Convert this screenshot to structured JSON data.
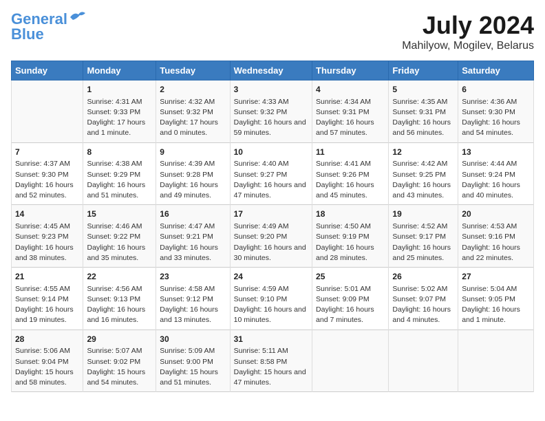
{
  "header": {
    "logo_line1": "General",
    "logo_line2": "Blue",
    "main_title": "July 2024",
    "subtitle": "Mahilyow, Mogilev, Belarus"
  },
  "columns": [
    "Sunday",
    "Monday",
    "Tuesday",
    "Wednesday",
    "Thursday",
    "Friday",
    "Saturday"
  ],
  "weeks": [
    [
      {
        "day": "",
        "sunrise": "",
        "sunset": "",
        "daylight": ""
      },
      {
        "day": "1",
        "sunrise": "Sunrise: 4:31 AM",
        "sunset": "Sunset: 9:33 PM",
        "daylight": "Daylight: 17 hours and 1 minute."
      },
      {
        "day": "2",
        "sunrise": "Sunrise: 4:32 AM",
        "sunset": "Sunset: 9:32 PM",
        "daylight": "Daylight: 17 hours and 0 minutes."
      },
      {
        "day": "3",
        "sunrise": "Sunrise: 4:33 AM",
        "sunset": "Sunset: 9:32 PM",
        "daylight": "Daylight: 16 hours and 59 minutes."
      },
      {
        "day": "4",
        "sunrise": "Sunrise: 4:34 AM",
        "sunset": "Sunset: 9:31 PM",
        "daylight": "Daylight: 16 hours and 57 minutes."
      },
      {
        "day": "5",
        "sunrise": "Sunrise: 4:35 AM",
        "sunset": "Sunset: 9:31 PM",
        "daylight": "Daylight: 16 hours and 56 minutes."
      },
      {
        "day": "6",
        "sunrise": "Sunrise: 4:36 AM",
        "sunset": "Sunset: 9:30 PM",
        "daylight": "Daylight: 16 hours and 54 minutes."
      }
    ],
    [
      {
        "day": "7",
        "sunrise": "Sunrise: 4:37 AM",
        "sunset": "Sunset: 9:30 PM",
        "daylight": "Daylight: 16 hours and 52 minutes."
      },
      {
        "day": "8",
        "sunrise": "Sunrise: 4:38 AM",
        "sunset": "Sunset: 9:29 PM",
        "daylight": "Daylight: 16 hours and 51 minutes."
      },
      {
        "day": "9",
        "sunrise": "Sunrise: 4:39 AM",
        "sunset": "Sunset: 9:28 PM",
        "daylight": "Daylight: 16 hours and 49 minutes."
      },
      {
        "day": "10",
        "sunrise": "Sunrise: 4:40 AM",
        "sunset": "Sunset: 9:27 PM",
        "daylight": "Daylight: 16 hours and 47 minutes."
      },
      {
        "day": "11",
        "sunrise": "Sunrise: 4:41 AM",
        "sunset": "Sunset: 9:26 PM",
        "daylight": "Daylight: 16 hours and 45 minutes."
      },
      {
        "day": "12",
        "sunrise": "Sunrise: 4:42 AM",
        "sunset": "Sunset: 9:25 PM",
        "daylight": "Daylight: 16 hours and 43 minutes."
      },
      {
        "day": "13",
        "sunrise": "Sunrise: 4:44 AM",
        "sunset": "Sunset: 9:24 PM",
        "daylight": "Daylight: 16 hours and 40 minutes."
      }
    ],
    [
      {
        "day": "14",
        "sunrise": "Sunrise: 4:45 AM",
        "sunset": "Sunset: 9:23 PM",
        "daylight": "Daylight: 16 hours and 38 minutes."
      },
      {
        "day": "15",
        "sunrise": "Sunrise: 4:46 AM",
        "sunset": "Sunset: 9:22 PM",
        "daylight": "Daylight: 16 hours and 35 minutes."
      },
      {
        "day": "16",
        "sunrise": "Sunrise: 4:47 AM",
        "sunset": "Sunset: 9:21 PM",
        "daylight": "Daylight: 16 hours and 33 minutes."
      },
      {
        "day": "17",
        "sunrise": "Sunrise: 4:49 AM",
        "sunset": "Sunset: 9:20 PM",
        "daylight": "Daylight: 16 hours and 30 minutes."
      },
      {
        "day": "18",
        "sunrise": "Sunrise: 4:50 AM",
        "sunset": "Sunset: 9:19 PM",
        "daylight": "Daylight: 16 hours and 28 minutes."
      },
      {
        "day": "19",
        "sunrise": "Sunrise: 4:52 AM",
        "sunset": "Sunset: 9:17 PM",
        "daylight": "Daylight: 16 hours and 25 minutes."
      },
      {
        "day": "20",
        "sunrise": "Sunrise: 4:53 AM",
        "sunset": "Sunset: 9:16 PM",
        "daylight": "Daylight: 16 hours and 22 minutes."
      }
    ],
    [
      {
        "day": "21",
        "sunrise": "Sunrise: 4:55 AM",
        "sunset": "Sunset: 9:14 PM",
        "daylight": "Daylight: 16 hours and 19 minutes."
      },
      {
        "day": "22",
        "sunrise": "Sunrise: 4:56 AM",
        "sunset": "Sunset: 9:13 PM",
        "daylight": "Daylight: 16 hours and 16 minutes."
      },
      {
        "day": "23",
        "sunrise": "Sunrise: 4:58 AM",
        "sunset": "Sunset: 9:12 PM",
        "daylight": "Daylight: 16 hours and 13 minutes."
      },
      {
        "day": "24",
        "sunrise": "Sunrise: 4:59 AM",
        "sunset": "Sunset: 9:10 PM",
        "daylight": "Daylight: 16 hours and 10 minutes."
      },
      {
        "day": "25",
        "sunrise": "Sunrise: 5:01 AM",
        "sunset": "Sunset: 9:09 PM",
        "daylight": "Daylight: 16 hours and 7 minutes."
      },
      {
        "day": "26",
        "sunrise": "Sunrise: 5:02 AM",
        "sunset": "Sunset: 9:07 PM",
        "daylight": "Daylight: 16 hours and 4 minutes."
      },
      {
        "day": "27",
        "sunrise": "Sunrise: 5:04 AM",
        "sunset": "Sunset: 9:05 PM",
        "daylight": "Daylight: 16 hours and 1 minute."
      }
    ],
    [
      {
        "day": "28",
        "sunrise": "Sunrise: 5:06 AM",
        "sunset": "Sunset: 9:04 PM",
        "daylight": "Daylight: 15 hours and 58 minutes."
      },
      {
        "day": "29",
        "sunrise": "Sunrise: 5:07 AM",
        "sunset": "Sunset: 9:02 PM",
        "daylight": "Daylight: 15 hours and 54 minutes."
      },
      {
        "day": "30",
        "sunrise": "Sunrise: 5:09 AM",
        "sunset": "Sunset: 9:00 PM",
        "daylight": "Daylight: 15 hours and 51 minutes."
      },
      {
        "day": "31",
        "sunrise": "Sunrise: 5:11 AM",
        "sunset": "Sunset: 8:58 PM",
        "daylight": "Daylight: 15 hours and 47 minutes."
      },
      {
        "day": "",
        "sunrise": "",
        "sunset": "",
        "daylight": ""
      },
      {
        "day": "",
        "sunrise": "",
        "sunset": "",
        "daylight": ""
      },
      {
        "day": "",
        "sunrise": "",
        "sunset": "",
        "daylight": ""
      }
    ]
  ]
}
